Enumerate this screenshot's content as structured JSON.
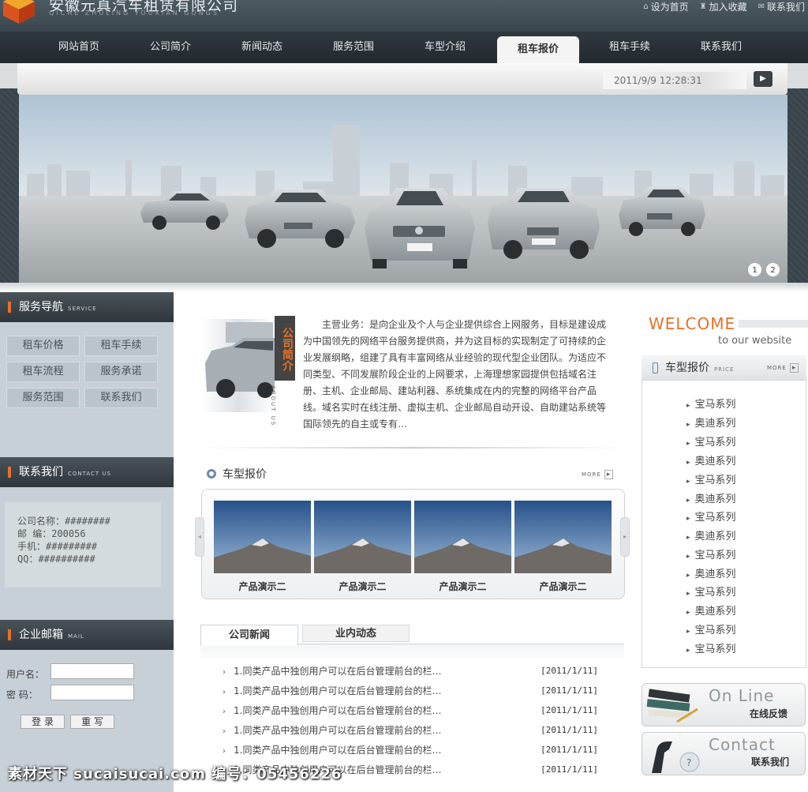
{
  "header": {
    "title": "安徽元真汽车租赁有限公司",
    "subtitle": "QICHE ZHULING YOUXIAN GONGS",
    "links": [
      {
        "label": "设为首页",
        "icon": "home-icon"
      },
      {
        "label": "加入收藏",
        "icon": "bookmark-icon"
      },
      {
        "label": "联系我们",
        "icon": "contact-icon"
      }
    ]
  },
  "nav": {
    "items": [
      "网站首页",
      "公司简介",
      "新闻动态",
      "服务范围",
      "车型介绍",
      "租车报价",
      "租车手续",
      "联系我们"
    ],
    "active": "租车报价"
  },
  "banner": {
    "datetime": "2011/9/9 12:28:31",
    "dots": [
      "1",
      "2"
    ]
  },
  "sidebar": {
    "service": {
      "title": "服务导航",
      "title_en": "SERVICE",
      "buttons": [
        "租车价格",
        "租车手续",
        "租车流程",
        "服务承诺",
        "服务范围",
        "联系我们"
      ]
    },
    "contact": {
      "title": "联系我们",
      "title_en": "CONTACT US",
      "lines": [
        "公司名称：########",
        "邮  编：200056",
        "手机：#########",
        "QQ：##########"
      ]
    },
    "mail": {
      "title": "企业邮箱",
      "title_en": "MAIL",
      "user_label": "用户名：",
      "pass_label": "密  码：",
      "login_label": "登 录",
      "reset_label": "重 写"
    }
  },
  "intro": {
    "label": "公司简介",
    "label_en": "ABOUT US",
    "text": "主营业务：是向企业及个人与企业提供综合上网服务，目标是建设成为中国领先的网络平台服务提供商，并为这目标的实现制定了可持续的企业发展纲略，组建了具有丰富网络从业经验的现代型企业团队。为适应不同类型、不同发展阶段企业的上网要求，上海理想家园提供包括域名注册、主机、企业邮局、建站利器、系统集成在内的完整的网络平台产品线。域名实时在线注册、虚拟主机、企业邮局自动开设、自助建站系统等国际领先的自主或专有…"
  },
  "products": {
    "title": "车型报价",
    "more": "MORE",
    "items": [
      "产品演示二",
      "产品演示二",
      "产品演示二",
      "产品演示二"
    ]
  },
  "news": {
    "tabs": [
      "公司新闻",
      "业内动态"
    ],
    "items": [
      {
        "title": "1.同类产品中独创用户可以在后台管理前台的栏…",
        "date": "[2011/1/11]"
      },
      {
        "title": "1.同类产品中独创用户可以在后台管理前台的栏…",
        "date": "[2011/1/11]"
      },
      {
        "title": "1.同类产品中独创用户可以在后台管理前台的栏…",
        "date": "[2011/1/11]"
      },
      {
        "title": "1.同类产品中独创用户可以在后台管理前台的栏…",
        "date": "[2011/1/11]"
      },
      {
        "title": "1.同类产品中独创用户可以在后台管理前台的栏…",
        "date": "[2011/1/11]"
      },
      {
        "title": "1.同类产品中独创用户可以在后台管理前台的栏…",
        "date": "[2011/1/11]"
      }
    ]
  },
  "right": {
    "welcome": "WELCOME",
    "to_site": "to our website",
    "price_title": "车型报价",
    "price_title_en": "PRICE",
    "price_more": "MORE",
    "price_items": [
      "宝马系列",
      "奥迪系列",
      "宝马系列",
      "奥迪系列",
      "宝马系列",
      "奥迪系列",
      "宝马系列",
      "奥迪系列",
      "宝马系列",
      "奥迪系列",
      "宝马系列",
      "奥迪系列",
      "宝马系列",
      "宝马系列"
    ],
    "online_en": "On Line",
    "online_cn": "在线反馈",
    "contact_en": "Contact",
    "contact_cn": "联系我们"
  },
  "watermark": "素材天下 sucaisucai.com  编号：05456226",
  "colors": {
    "accent": "#e8702a",
    "nav_bg": "#2a3237",
    "sidebar_bg": "#c7d0d6"
  }
}
